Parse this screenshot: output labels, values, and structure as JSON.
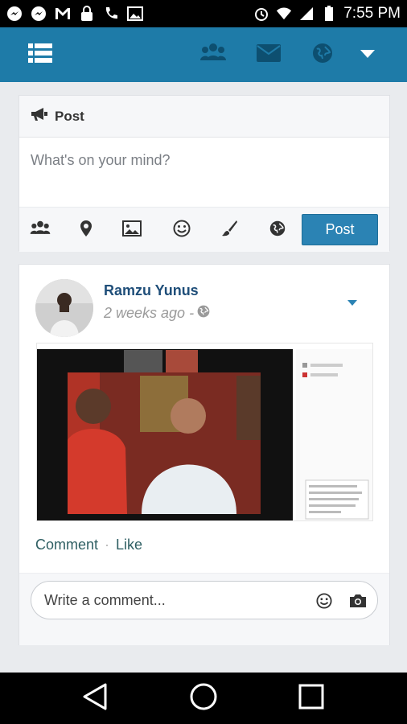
{
  "status_bar": {
    "time": "7:55 PM",
    "left_icons": [
      "messenger-icon",
      "messenger-icon",
      "gmail-icon",
      "lock-icon",
      "phone-icon",
      "image-icon"
    ],
    "right_icons": [
      "alarm-icon",
      "wifi-icon",
      "signal-icon",
      "battery-icon"
    ]
  },
  "app_bar": {
    "color": "#1e7ba8",
    "icons": [
      "menu-icon",
      "friends-icon",
      "messages-icon",
      "globe-icon",
      "dropdown-icon"
    ]
  },
  "composer": {
    "title": "Post",
    "placeholder": "What's on your mind?",
    "tools": [
      "friends-icon",
      "location-icon",
      "photo-icon",
      "emoji-icon",
      "brush-icon",
      "privacy-icon"
    ],
    "post_button": "Post"
  },
  "post": {
    "author": "Ramzu Yunus",
    "time": "2 weeks ago -",
    "actions": {
      "comment": "Comment",
      "separator": "·",
      "like": "Like"
    },
    "comment_placeholder": "Write a comment..."
  }
}
